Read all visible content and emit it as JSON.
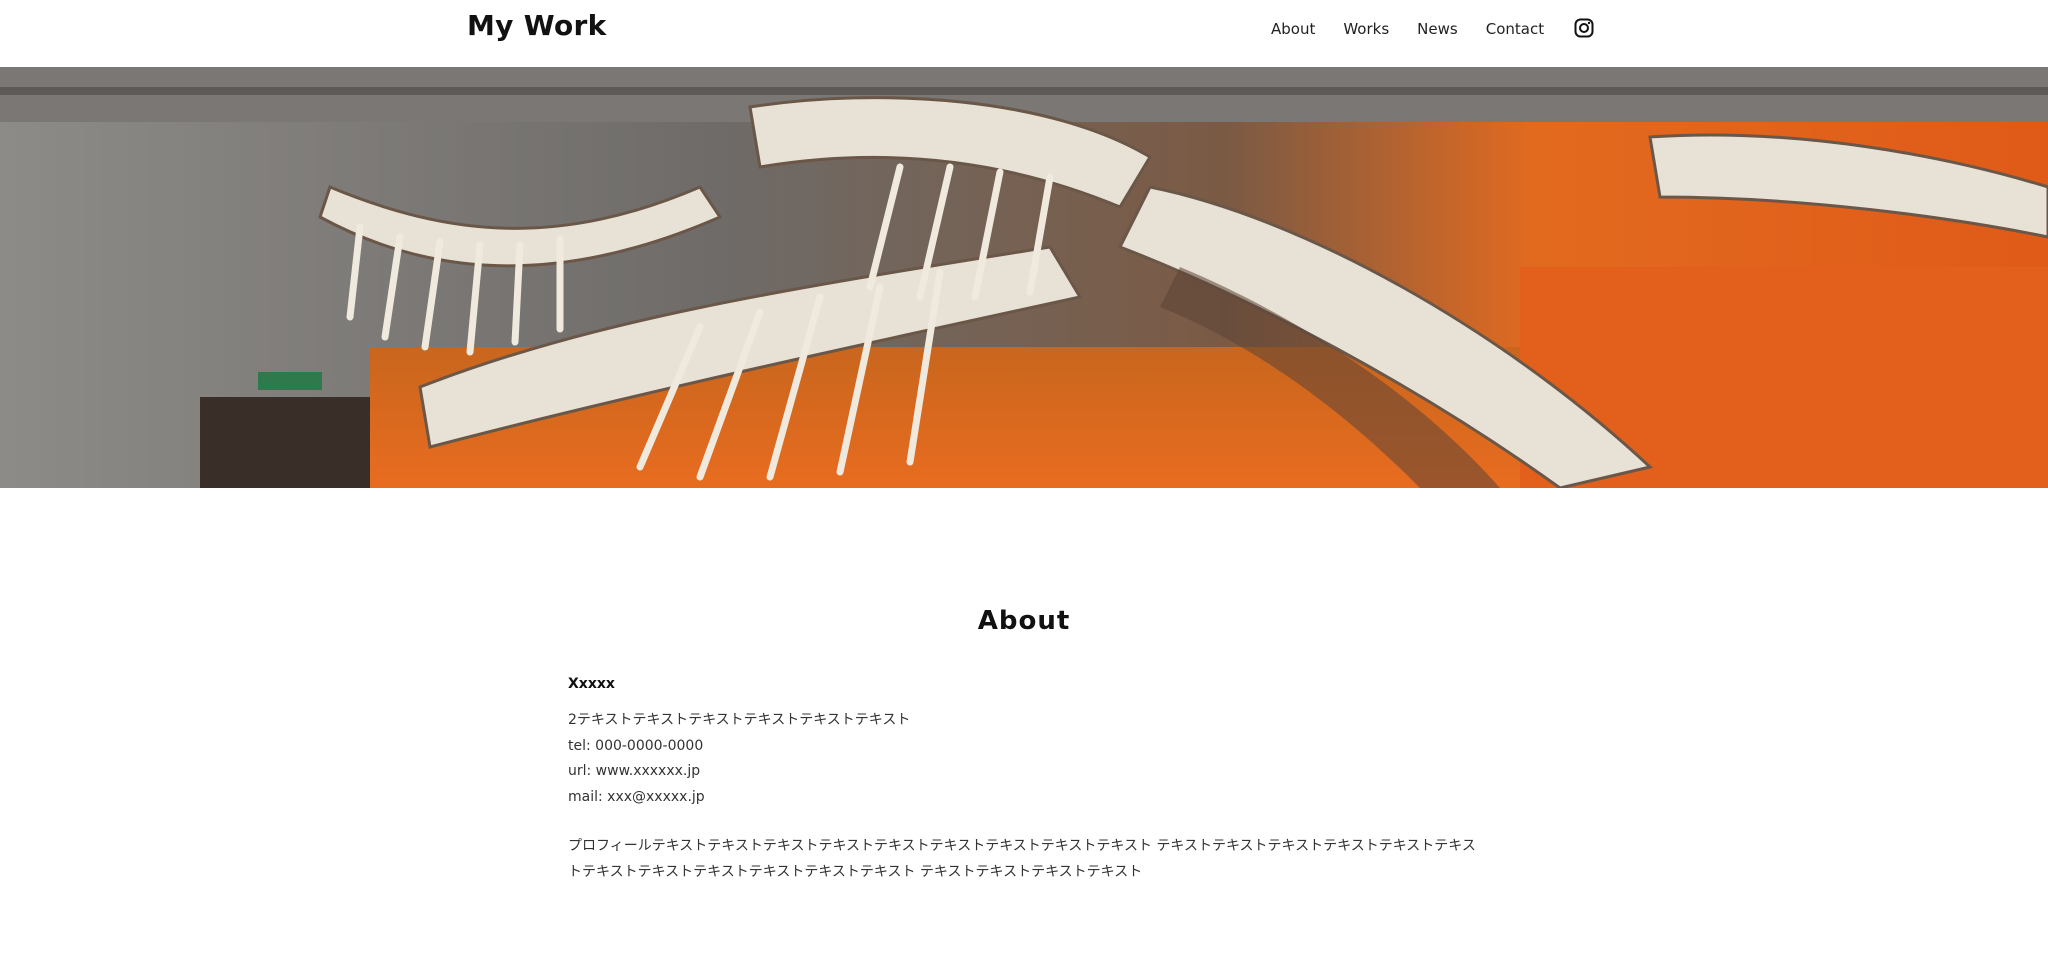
{
  "site": {
    "title": "My Work"
  },
  "nav": {
    "items": [
      {
        "label": "About"
      },
      {
        "label": "Works"
      },
      {
        "label": "News"
      },
      {
        "label": "Contact"
      }
    ],
    "instagram_icon": "instagram-icon"
  },
  "hero": {
    "icon": "dinosaur-skeleton-photo"
  },
  "about": {
    "title": "About",
    "name": "Xxxxx",
    "lines": [
      "2テキストテキストテキストテキストテキストテキスト",
      "tel: 000-0000-0000",
      "url: www.xxxxxx.jp",
      "mail: xxx@xxxxx.jp"
    ],
    "profile": "プロフィールテキストテキストテキストテキストテキストテキストテキストテキストテキスト テキストテキストテキストテキストテキストテキストテキストテキストテキストテキストテキストテキスト テキストテキストテキストテキスト"
  }
}
